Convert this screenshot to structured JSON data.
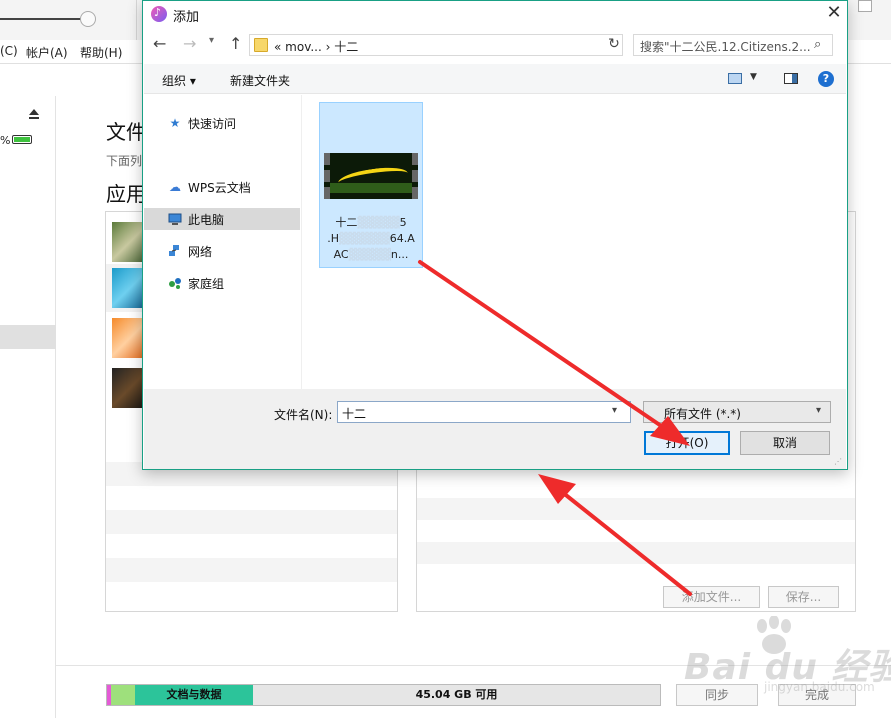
{
  "background_app": {
    "menu": {
      "items": [
        "(C)",
        "帐户(A)",
        "帮助(H)"
      ]
    },
    "battery_pct": "%",
    "heading_1": "文件",
    "description": "下面列",
    "heading_2": "应用",
    "buttons": {
      "add_file": "添加文件...",
      "save": "保存..."
    },
    "footer": {
      "capacity_segment_label": "文档与数据",
      "free_space": "45.04 GB 可用",
      "sync_button": "同步",
      "done_button": "完成"
    }
  },
  "dialog": {
    "title": "添加",
    "address": {
      "text": "« mov... › 十二"
    },
    "search": {
      "placeholder": "搜索\"十二公民.12.Citizens.2..."
    },
    "toolbar": {
      "organize": "组织 ▾",
      "new_folder": "新建文件夹"
    },
    "nav": {
      "items": [
        {
          "label": "快速访问",
          "icon": "star-icon"
        },
        {
          "label": "WPS云文档",
          "icon": "cloud-icon"
        },
        {
          "label": "此电脑",
          "icon": "computer-icon",
          "selected": true
        },
        {
          "label": "网络",
          "icon": "network-icon"
        },
        {
          "label": "家庭组",
          "icon": "homegroup-icon"
        }
      ]
    },
    "file": {
      "name_lines": [
        "十二",
        "5",
        ".H",
        "64.A",
        "AC",
        "n..."
      ]
    },
    "filename": {
      "label": "文件名(N):",
      "value": "十二"
    },
    "filetype": {
      "value": "所有文件 (*.*)"
    },
    "buttons": {
      "open": "打开(O)",
      "cancel": "取消"
    }
  },
  "watermark": {
    "text": "Bai du 经验",
    "url": "jingyan.baidu.com"
  },
  "colors": {
    "dialog_border": "#19a085",
    "selected_tile": "#cce8ff",
    "primary_button_border": "#0078d7",
    "capacity_green": "#2cc49a",
    "arrow_red": "#ee2b2b"
  }
}
